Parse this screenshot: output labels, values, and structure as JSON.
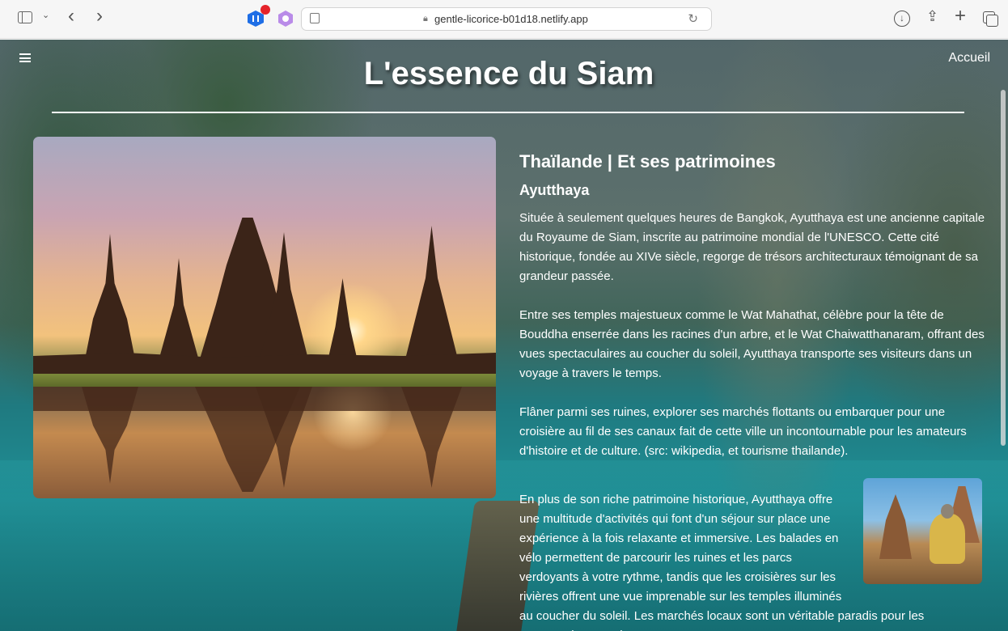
{
  "browser": {
    "url": "gentle-licorice-b01d18.netlify.app",
    "lock_icon": "lock-icon",
    "reload_icon": "reload-icon"
  },
  "nav": {
    "home_link": "Accueil"
  },
  "page": {
    "title": "L'essence du Siam"
  },
  "article": {
    "heading": "Thaïlande | Et ses patrimoines",
    "subheading": "Ayutthaya",
    "paragraphs": [
      "Située à seulement quelques heures de Bangkok, Ayutthaya est une ancienne capitale du Royaume de Siam, inscrite au patrimoine mondial de l'UNESCO. Cette cité historique, fondée au XIVe siècle, regorge de trésors architecturaux témoignant de sa grandeur passée.",
      "Entre ses temples majestueux comme le Wat Mahathat, célèbre pour la tête de Bouddha enserrée dans les racines d'un arbre, et le Wat Chaiwatthanaram, offrant des vues spectaculaires au coucher du soleil, Ayutthaya transporte ses visiteurs dans un voyage à travers le temps.",
      "Flâner parmi ses ruines, explorer ses marchés flottants ou embarquer pour une croisière au fil de ses canaux fait de cette ville un incontournable pour les amateurs d'histoire et de culture. (src: wikipedia, et tourisme thailande).",
      "En plus de son riche patrimoine historique, Ayutthaya offre une multitude d'activités qui font d'un séjour sur place une expérience à la fois relaxante et immersive. Les balades en vélo permettent de parcourir les ruines et les parcs verdoyants à votre rythme, tandis que les croisières sur les rivières offrent une vue imprenable sur les temples illuminés au coucher du soleil. Les marchés locaux sont un véritable paradis pour les gourmands, avec des"
    ]
  },
  "colors": {
    "text": "#ffffff",
    "chrome_bg": "#f6f6f6",
    "ext_blue": "#1e6ee6",
    "ext_purple": "#b98be8",
    "badge_red": "#e5232a"
  }
}
